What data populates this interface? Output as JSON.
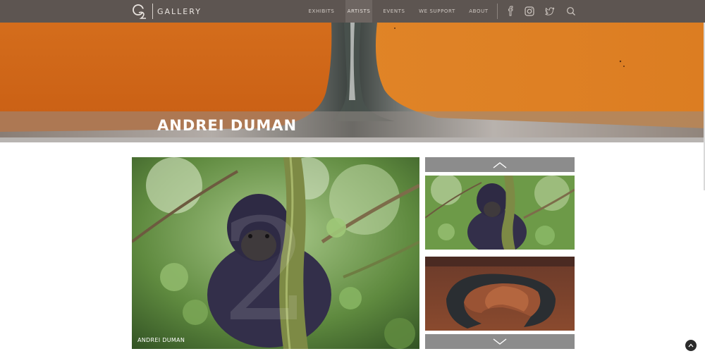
{
  "brand": {
    "logo_text": "GALLERY",
    "logo_mark": "G2"
  },
  "nav": {
    "items": [
      {
        "label": "EXHIBITS",
        "active": false
      },
      {
        "label": "ARTISTS",
        "active": true
      },
      {
        "label": "EVENTS",
        "active": false
      },
      {
        "label": "WE SUPPORT",
        "active": false
      },
      {
        "label": "ABOUT",
        "active": false
      }
    ],
    "icons": [
      "facebook-icon",
      "instagram-icon",
      "twitter-icon",
      "search-icon"
    ]
  },
  "hero": {
    "title": "ANDREI DUMAN"
  },
  "main_photo": {
    "caption": "ANDREI DUMAN"
  },
  "thumbnails": [
    "gorilla-thumbnail",
    "horseshoe-bend-thumbnail"
  ],
  "colors": {
    "topbar": "#5d5551",
    "hero_orange": "#d8711f",
    "thumb_nav": "#8c8c8c"
  }
}
